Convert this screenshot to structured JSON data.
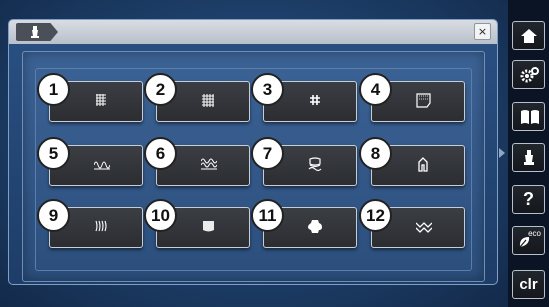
{
  "header": {
    "tab_icon": "presser-foot-icon",
    "close_label": "×"
  },
  "stitch_buttons": [
    {
      "number": "1",
      "icon": "straight-stitch-icon"
    },
    {
      "number": "2",
      "icon": "zigzag-stitch-icon"
    },
    {
      "number": "3",
      "icon": "darning-stitch-icon"
    },
    {
      "number": "4",
      "icon": "patch-stitch-icon"
    },
    {
      "number": "5",
      "icon": "stretch-stitch-icon"
    },
    {
      "number": "6",
      "icon": "overlock-stitch-icon"
    },
    {
      "number": "7",
      "icon": "honeycomb-stitch-icon"
    },
    {
      "number": "8",
      "icon": "shirt-stitch-icon"
    },
    {
      "number": "9",
      "icon": "quilt-stitch-icon"
    },
    {
      "number": "10",
      "icon": "blind-hem-stitch-icon"
    },
    {
      "number": "11",
      "icon": "leather-stitch-icon"
    },
    {
      "number": "12",
      "icon": "decorative-stitch-icon"
    }
  ],
  "sidebar": {
    "home_icon": "home-icon",
    "setup_icon": "setup-gear-icon",
    "manual_icon": "book-icon",
    "foot_icon": "presser-foot-icon",
    "help_label": "?",
    "eco_label": "eco",
    "clear_label": "clr"
  }
}
